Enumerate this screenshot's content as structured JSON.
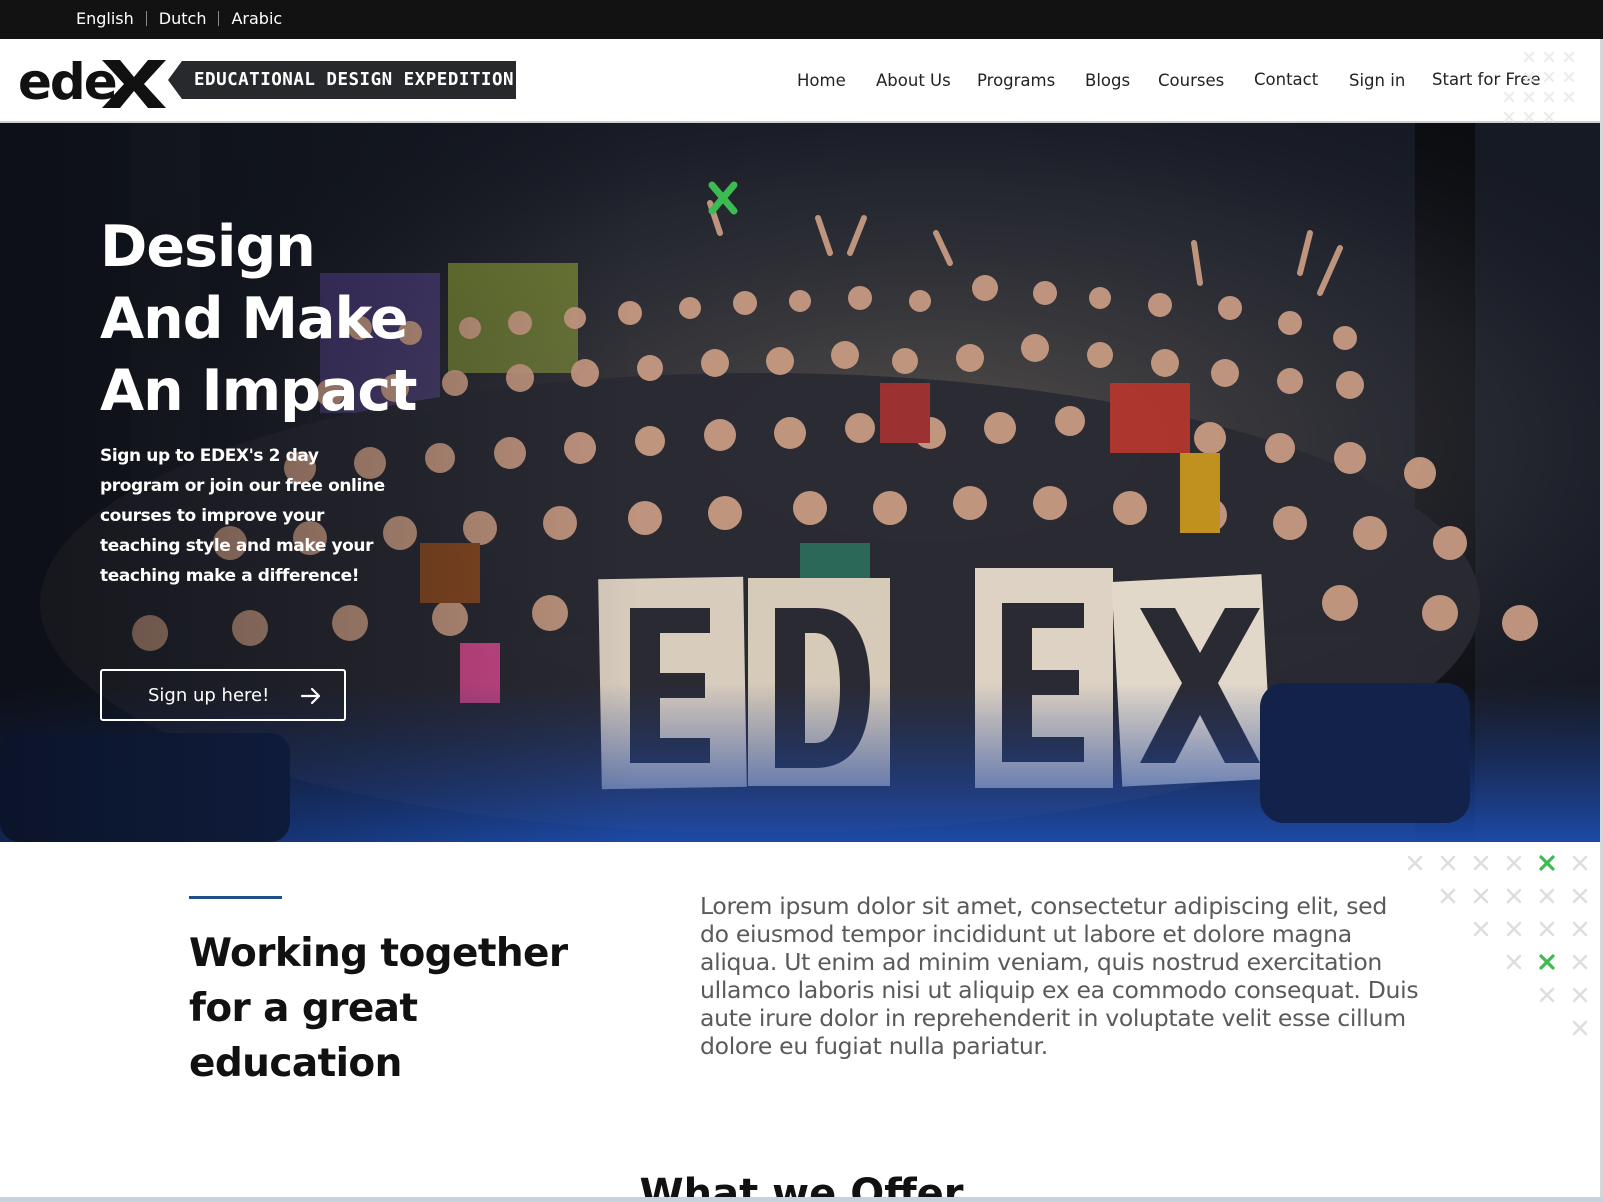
{
  "languages": [
    "English",
    "Dutch",
    "Arabic"
  ],
  "logo": {
    "wordmark": "ede",
    "tagline": "EDUCATIONAL DESIGN EXPEDITION"
  },
  "nav": {
    "items": [
      "Home",
      "About Us",
      "Programs",
      "Blogs",
      "Courses",
      "Contact",
      "Sign in",
      "Start for Free"
    ]
  },
  "hero": {
    "title_lines": [
      "Design",
      "And Make",
      "An Impact"
    ],
    "subtitle": "Sign up to EDEX's 2 day program or join our free online courses to improve your teaching style and make your teaching make a difference!",
    "cta_label": "Sign up here!",
    "cta_icon": "arrow-right-icon",
    "photo_letters": [
      "E",
      "D",
      "E",
      "X"
    ]
  },
  "intro": {
    "title_lines": [
      "Working together",
      "for a great",
      "education"
    ],
    "body": "Lorem ipsum dolor sit amet, consectetur adipiscing elit, sed do eiusmod tempor incididunt ut labore et dolore magna aliqua. Ut enim ad minim veniam, quis nostrud exercitation ullamco laboris nisi ut aliquip ex ea commodo consequat. Duis aute irure dolor in reprehenderit in voluptate velit esse cillum dolore eu fugiat nulla pariatur."
  },
  "offer": {
    "title": "What we Offer"
  },
  "colors": {
    "topbar": "#121212",
    "accent_blue": "#1f4e8c",
    "accent_green": "#3dbb53",
    "tagline_bg": "#27292c",
    "body_text": "#5a5a5a"
  }
}
